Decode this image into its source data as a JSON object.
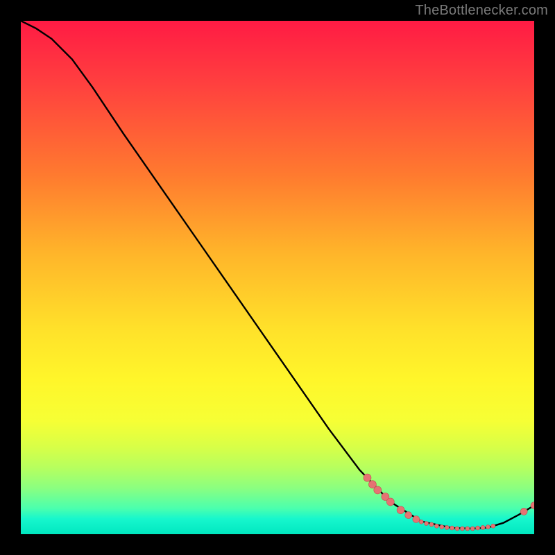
{
  "watermark": "TheBottlenecker.com",
  "colors": {
    "curve_stroke": "#000000",
    "marker_fill": "#e57373",
    "marker_stroke": "#c45050",
    "background": "#000000"
  },
  "chart_data": {
    "type": "line",
    "title": "",
    "xlabel": "",
    "ylabel": "",
    "xlim": [
      0,
      100
    ],
    "ylim": [
      0,
      100
    ],
    "grid": false,
    "legend": false,
    "curve": [
      {
        "x": 0,
        "y": 100
      },
      {
        "x": 3,
        "y": 98.5
      },
      {
        "x": 6,
        "y": 96.5
      },
      {
        "x": 10,
        "y": 92.5
      },
      {
        "x": 14,
        "y": 87
      },
      {
        "x": 20,
        "y": 78
      },
      {
        "x": 28,
        "y": 66.5
      },
      {
        "x": 36,
        "y": 55
      },
      {
        "x": 44,
        "y": 43.5
      },
      {
        "x": 52,
        "y": 32
      },
      {
        "x": 60,
        "y": 20.5
      },
      {
        "x": 66,
        "y": 12.5
      },
      {
        "x": 72,
        "y": 6.3
      },
      {
        "x": 78,
        "y": 2.5
      },
      {
        "x": 84,
        "y": 1.2
      },
      {
        "x": 88,
        "y": 1.1
      },
      {
        "x": 91,
        "y": 1.3
      },
      {
        "x": 94,
        "y": 2.2
      },
      {
        "x": 97,
        "y": 3.8
      },
      {
        "x": 100,
        "y": 5.6
      }
    ],
    "markers": [
      {
        "x": 67.5,
        "y": 11.0,
        "r": 5.5
      },
      {
        "x": 68.5,
        "y": 9.7,
        "r": 5.5
      },
      {
        "x": 69.5,
        "y": 8.6,
        "r": 5.5
      },
      {
        "x": 71.0,
        "y": 7.3,
        "r": 5.5
      },
      {
        "x": 72.0,
        "y": 6.3,
        "r": 5.5
      },
      {
        "x": 74.0,
        "y": 4.7,
        "r": 5.5
      },
      {
        "x": 75.5,
        "y": 3.7,
        "r": 5.0
      },
      {
        "x": 77.0,
        "y": 2.9,
        "r": 5.0
      },
      {
        "x": 78.0,
        "y": 2.4,
        "r": 3.0
      },
      {
        "x": 79.0,
        "y": 2.1,
        "r": 3.0
      },
      {
        "x": 80.0,
        "y": 1.9,
        "r": 3.0
      },
      {
        "x": 81.0,
        "y": 1.6,
        "r": 3.0
      },
      {
        "x": 82.0,
        "y": 1.4,
        "r": 3.0
      },
      {
        "x": 83.0,
        "y": 1.3,
        "r": 3.0
      },
      {
        "x": 84.0,
        "y": 1.2,
        "r": 3.0
      },
      {
        "x": 85.0,
        "y": 1.1,
        "r": 3.0
      },
      {
        "x": 86.0,
        "y": 1.1,
        "r": 3.0
      },
      {
        "x": 87.0,
        "y": 1.1,
        "r": 3.0
      },
      {
        "x": 88.0,
        "y": 1.1,
        "r": 3.0
      },
      {
        "x": 89.0,
        "y": 1.2,
        "r": 3.0
      },
      {
        "x": 90.0,
        "y": 1.3,
        "r": 3.0
      },
      {
        "x": 91.0,
        "y": 1.4,
        "r": 3.0
      },
      {
        "x": 92.0,
        "y": 1.6,
        "r": 3.0
      },
      {
        "x": 98.0,
        "y": 4.4,
        "r": 5.0
      },
      {
        "x": 100.0,
        "y": 5.6,
        "r": 5.0
      }
    ]
  }
}
